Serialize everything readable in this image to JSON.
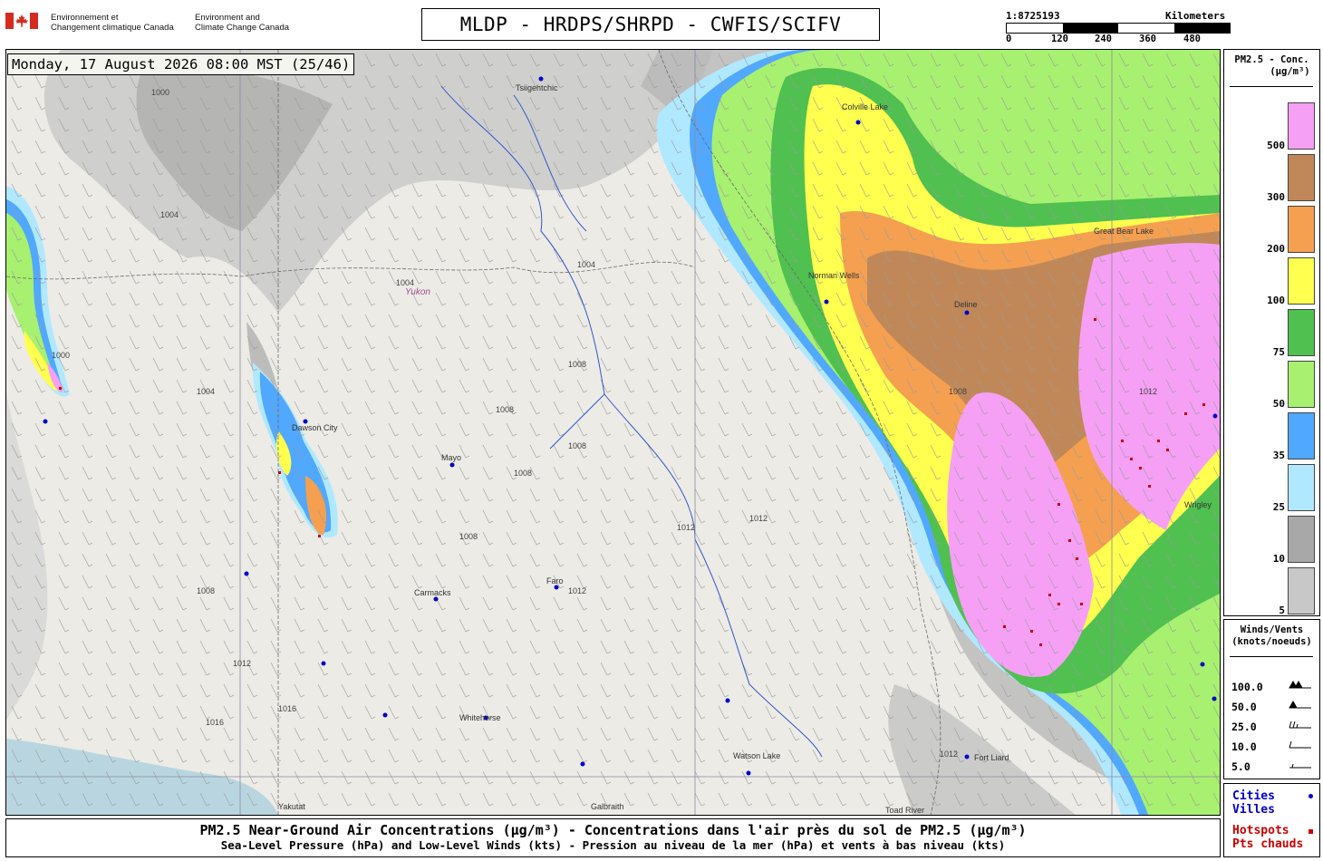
{
  "header": {
    "dept_fr": [
      "Environnement et",
      "Changement climatique Canada"
    ],
    "dept_en": [
      "Environment and",
      "Climate Change Canada"
    ],
    "title": "MLDP - HRDPS/SHRPD - CWFIS/SCIFV"
  },
  "scale": {
    "ratio": "1:8725193",
    "units": "Kilometers",
    "ticks": [
      "0",
      "120",
      "240",
      "360",
      "480"
    ]
  },
  "map": {
    "datestamp": "Monday, 17 August 2026 08:00 MST (25/46)",
    "region_label": "Yukon",
    "places": [
      {
        "name": "Tsiigehtchic"
      },
      {
        "name": "Colville Lake"
      },
      {
        "name": "Great Bear Lake"
      },
      {
        "name": "Deline"
      },
      {
        "name": "Norman Wells"
      },
      {
        "name": "Dawson City"
      },
      {
        "name": "Mayo"
      },
      {
        "name": "Faro"
      },
      {
        "name": "Carmacks"
      },
      {
        "name": "Whitehorse"
      },
      {
        "name": "Watson Lake"
      },
      {
        "name": "Fort Liard"
      },
      {
        "name": "Yakutat"
      },
      {
        "name": "Galbraith"
      },
      {
        "name": "Toad River"
      },
      {
        "name": "Wrigley"
      }
    ],
    "isobar_labels": [
      "1000",
      "1004",
      "1008",
      "1012",
      "1016"
    ]
  },
  "legend_concentration": {
    "title": [
      "PM2.5 - Conc.",
      "(μg/m³)"
    ],
    "bins": [
      {
        "label": "500",
        "color": "#f5a0f5"
      },
      {
        "label": "300",
        "color": "#c08858"
      },
      {
        "label": "200",
        "color": "#f5a050"
      },
      {
        "label": "100",
        "color": "#ffff50"
      },
      {
        "label": "75",
        "color": "#50c050"
      },
      {
        "label": "50",
        "color": "#a8f070"
      },
      {
        "label": "35",
        "color": "#50a8ff"
      },
      {
        "label": "25",
        "color": "#b0e8ff"
      },
      {
        "label": "10",
        "color": "#a8a8a8"
      },
      {
        "label": "5",
        "color": "#c8c8c8"
      }
    ]
  },
  "legend_wind": {
    "title": [
      "Winds/Vents",
      "(knots/noeuds)"
    ],
    "rows": [
      "100.0",
      "50.0",
      "25.0",
      "10.0",
      "5.0"
    ]
  },
  "legend_points": {
    "cities": [
      "Cities",
      "Villes"
    ],
    "cities_color": "#0000cc",
    "hotspots": [
      "Hotspots",
      "Pts chauds"
    ],
    "hotspots_color": "#cc0000"
  },
  "footer": {
    "line1": "PM2.5 Near-Ground Air Concentrations (μg/m³) - Concentrations dans l'air près du sol de PM2.5 (μg/m³)",
    "line2": "Sea-Level Pressure (hPa) and Low-Level Winds (kts) - Pression au niveau de la mer (hPa) et vents à bas niveau (kts)"
  }
}
